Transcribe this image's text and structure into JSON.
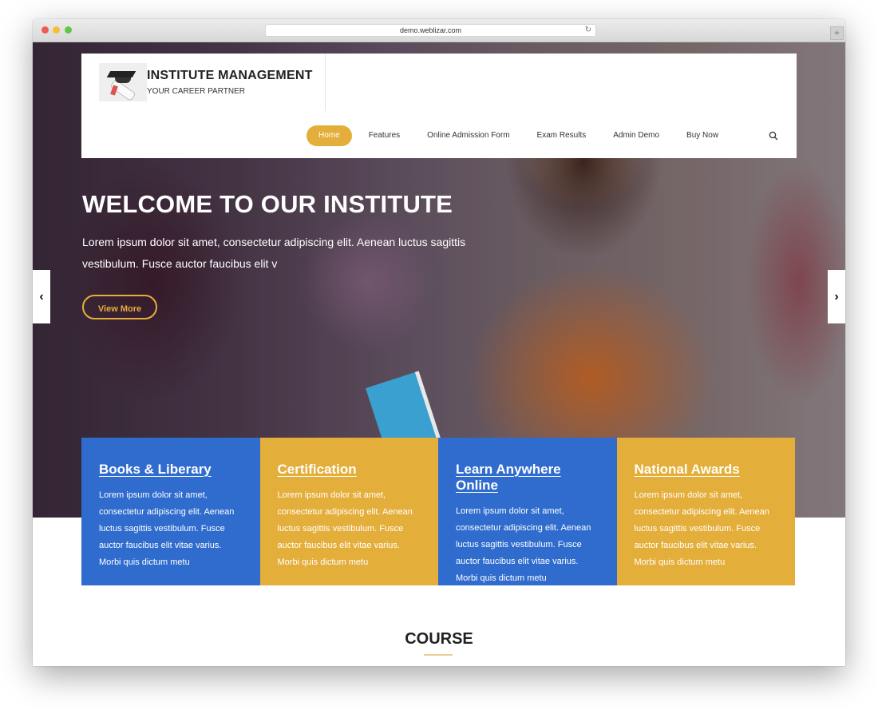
{
  "browser": {
    "url": "demo.weblizar.com",
    "reload_icon": "↻",
    "new_tab_icon": "+"
  },
  "header": {
    "logo_icon": "graduation-cap-diploma",
    "title": "INSTITUTE MANAGEMENT",
    "tagline": "YOUR CAREER PARTNER"
  },
  "nav": {
    "items": [
      {
        "label": "Home",
        "active": true
      },
      {
        "label": "Features",
        "active": false
      },
      {
        "label": "Online Admission Form",
        "active": false
      },
      {
        "label": "Exam Results",
        "active": false
      },
      {
        "label": "Admin Demo",
        "active": false
      },
      {
        "label": "Buy Now",
        "active": false
      }
    ],
    "search_icon": "search-icon"
  },
  "hero": {
    "title": "WELCOME TO OUR INSTITUTE",
    "text": "Lorem ipsum dolor sit amet, consectetur adipiscing elit. Aenean luctus sagittis vestibulum. Fusce auctor faucibus elit v",
    "button_label": "View More",
    "prev_icon": "‹",
    "next_icon": "›"
  },
  "features": [
    {
      "title": "Books & Liberary",
      "text": "Lorem ipsum dolor sit amet, consectetur adipiscing elit. Aenean luctus sagittis vestibulum. Fusce auctor faucibus elit vitae varius. Morbi quis dictum metu",
      "color": "#2f6ccd"
    },
    {
      "title": "Certification",
      "text": "Lorem ipsum dolor sit amet, consectetur adipiscing elit. Aenean luctus sagittis vestibulum. Fusce auctor faucibus elit vitae varius. Morbi quis dictum metu",
      "color": "#e4ae3b"
    },
    {
      "title": "Learn Anywhere Online",
      "text": "Lorem ipsum dolor sit amet, consectetur adipiscing elit. Aenean luctus sagittis vestibulum. Fusce auctor faucibus elit vitae varius. Morbi quis dictum metu",
      "color": "#2f6ccd"
    },
    {
      "title": "National Awards",
      "text": "Lorem ipsum dolor sit amet, consectetur adipiscing elit. Aenean luctus sagittis vestibulum. Fusce auctor faucibus elit vitae varius. Morbi quis dictum metu",
      "color": "#e4ae3b"
    }
  ],
  "course": {
    "title": "COURSE"
  },
  "colors": {
    "accent_gold": "#e4ae3b",
    "accent_blue": "#2f6ccd"
  }
}
